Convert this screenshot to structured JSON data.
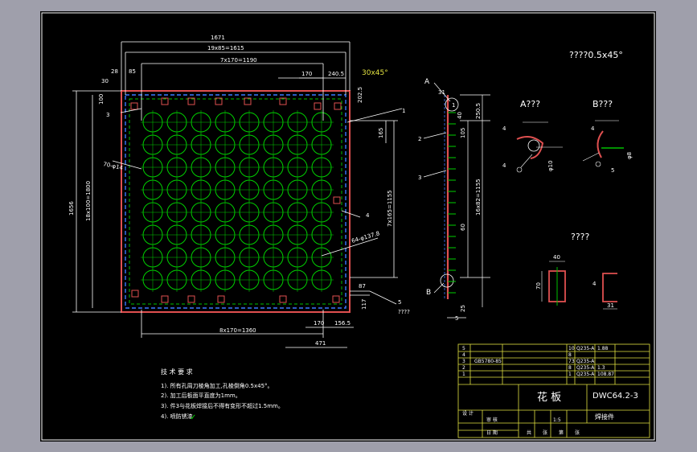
{
  "drawing": {
    "chamfer_note": "????0.5x45°",
    "chamfer_label": "30x45°",
    "dimensions": {
      "overall_width": "1671",
      "bolt_span": "19x85=1615",
      "hole_span_top": "7x170=1190",
      "d170_top": "170",
      "d240_5": "240.5",
      "d85": "85",
      "d28": "28",
      "d30": "30",
      "d100": "100",
      "d202_5": "202.5",
      "overall_height": "1656",
      "left_bolt": "18x100=1800",
      "hole_span_right": "7x165=1155",
      "d165": "165",
      "bottom_span": "8x170=1360",
      "d170_bottom": "170",
      "d156_5": "156.5",
      "d471": "471",
      "d87": "87",
      "d117": "117",
      "d250_5": "250.5",
      "d40": "40",
      "d105": "105",
      "side_span": "16x82=1155",
      "d60": "60",
      "d25": "25",
      "d5": "5",
      "holes_note": "64-φ137.8",
      "bolt_note": "70-φ14",
      "mark_1": "1",
      "mark_3": "3",
      "mark_4": "4",
      "mark_5": "5",
      "mark_5_text": "????",
      "side_2": "2",
      "side_3": "3",
      "label_A": "A",
      "label_B": "B",
      "d31_side": "31",
      "label_1_side": "1"
    },
    "details": {
      "view_A": "A???",
      "view_B": "B???",
      "view_C": "????",
      "a_4a": "4",
      "a_4b": "4",
      "a_phi": "φ10",
      "b_4": "4",
      "b_5": "5",
      "b_phi": "φ8",
      "c_40": "40",
      "c_70": "70",
      "c_31": "31",
      "c_4": "4"
    },
    "notes": {
      "heading": "技 术 要 求",
      "line1": "1). 所有孔周刀棱角加工,孔棱倒角0.5x45°。",
      "line2": "2). 加工后板面平直度为1mm。",
      "line3": "3). 件3与花板焊接后不得有变形不超过1.5mm。",
      "line4": "4). 喷防锈漆"
    },
    "title_block": {
      "part_name": "花  板",
      "drawing_no": "DWC64.2-3",
      "subtitle": "焊接件",
      "row5": "5",
      "row4": "4",
      "row3": "3",
      "row2": "2",
      "row1": "1",
      "row4_std": "GB5780-85",
      "row5_qty": "10",
      "row5_mat": "Q235-A",
      "row5_wt": "1.88",
      "row4_qty": "8",
      "row3_qty": "73",
      "row3_mat": "Q235-A",
      "row2_qty": "8",
      "row2_mat": "Q235-A",
      "row2_wt": "1.3",
      "row1_qty": "1",
      "row1_mat": "Q235-A",
      "row1_wt": "108.87",
      "check": "审 核",
      "date": "日 期",
      "design": "设 计",
      "scale": "1:5",
      "sheets_a": "共",
      "sheets_b": "张",
      "sheet_a": "第",
      "sheet_b": "张"
    }
  }
}
